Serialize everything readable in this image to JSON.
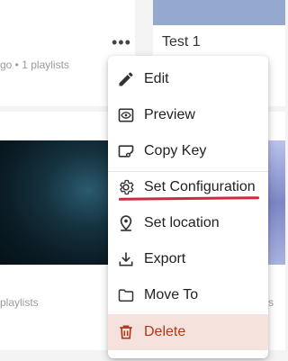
{
  "cards": {
    "top_left": {
      "meta": "go • 1 playlists",
      "more_icon": "more-horizontal-icon"
    },
    "top_right": {
      "title": "Test 1"
    },
    "bottom_left": {
      "meta": "playlists"
    },
    "bottom_right": {
      "meta": "s"
    }
  },
  "menu": {
    "items": [
      {
        "label": "Edit",
        "icon": "pencil-icon"
      },
      {
        "label": "Preview",
        "icon": "eye-icon"
      },
      {
        "label": "Copy Key",
        "icon": "copy-key-icon"
      },
      {
        "label": "Set Configuration",
        "icon": "gear-icon"
      },
      {
        "label": "Set location",
        "icon": "location-pin-icon"
      },
      {
        "label": "Export",
        "icon": "download-icon"
      },
      {
        "label": "Move To",
        "icon": "folder-icon"
      },
      {
        "label": "Delete",
        "icon": "trash-icon"
      }
    ]
  },
  "colors": {
    "delete_text": "#b3361a",
    "delete_bg": "#f6e2dc",
    "highlight_underline": "#d0283f"
  }
}
